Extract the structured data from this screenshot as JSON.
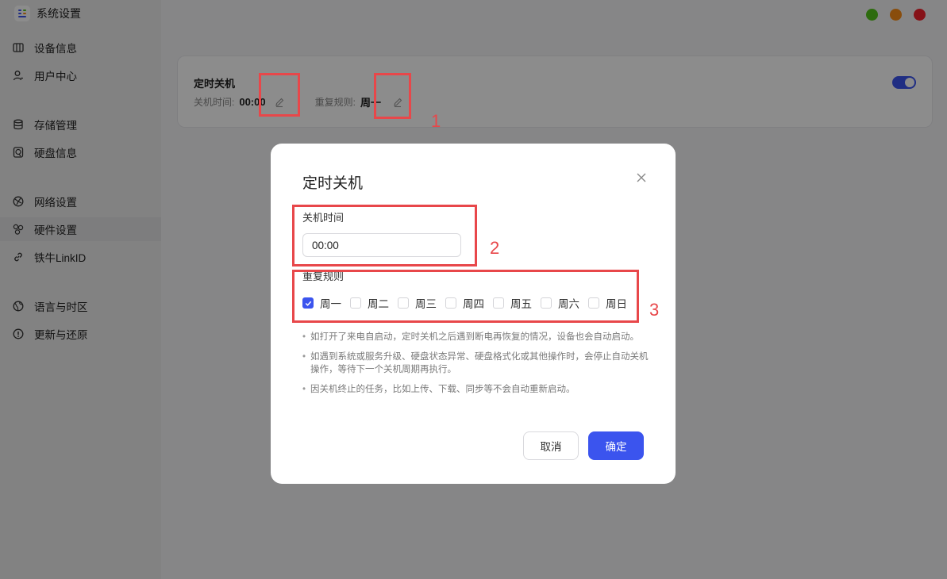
{
  "app": {
    "title": "系统设置"
  },
  "sidebar": {
    "items": [
      {
        "label": "设备信息",
        "icon": "device-info-icon"
      },
      {
        "label": "用户中心",
        "icon": "user-icon"
      },
      {
        "label": "存储管理",
        "icon": "storage-icon"
      },
      {
        "label": "硬盘信息",
        "icon": "disk-icon"
      },
      {
        "label": "网络设置",
        "icon": "network-icon"
      },
      {
        "label": "硬件设置",
        "icon": "hardware-icon",
        "active": true
      },
      {
        "label": "铁牛LinkID",
        "icon": "link-icon"
      },
      {
        "label": "语言与时区",
        "icon": "globe-icon"
      },
      {
        "label": "更新与还原",
        "icon": "info-icon"
      }
    ]
  },
  "window_controls": {
    "colors": [
      "#52c41a",
      "#fa8c16",
      "#f5222d"
    ]
  },
  "card": {
    "title": "定时关机",
    "time_label": "关机时间:",
    "time_value": "00:00",
    "repeat_label": "重复规则:",
    "repeat_value": "周一",
    "enabled": true
  },
  "dialog": {
    "title": "定时关机",
    "time_label": "关机时间",
    "time_value": "00:00",
    "repeat_label": "重复规则",
    "days": [
      {
        "label": "周一",
        "checked": true
      },
      {
        "label": "周二",
        "checked": false
      },
      {
        "label": "周三",
        "checked": false
      },
      {
        "label": "周四",
        "checked": false
      },
      {
        "label": "周五",
        "checked": false
      },
      {
        "label": "周六",
        "checked": false
      },
      {
        "label": "周日",
        "checked": false
      }
    ],
    "notes": [
      "如打开了来电自启动，定时关机之后遇到断电再恢复的情况，设备也会自动启动。",
      "如遇到系统或服务升级、硬盘状态异常、硬盘格式化或其他操作时，会停止自动关机操作，等待下一个关机周期再执行。",
      "因关机终止的任务，比如上传、下载、同步等不会自动重新启动。"
    ],
    "cancel_label": "取消",
    "ok_label": "确定"
  },
  "annotations": [
    "1",
    "2",
    "3"
  ],
  "colors": {
    "accent": "#3b54ee",
    "annotation": "#e8474a"
  }
}
